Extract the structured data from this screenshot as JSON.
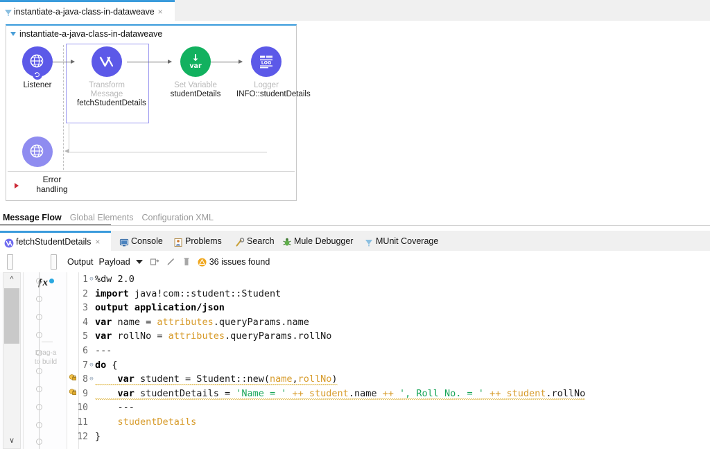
{
  "top_tab": {
    "title": "instantiate-a-java-class-in-dataweave",
    "close": "×",
    "icon": "munit-coverage-icon"
  },
  "flow": {
    "name": "instantiate-a-java-class-in-dataweave",
    "nodes": [
      {
        "id": "listener",
        "type": "Listener",
        "label": "Listener",
        "config": "",
        "icon": "http-globe-icon",
        "color": "#5c59e8",
        "dimmed_label": false
      },
      {
        "id": "transform",
        "type": "Transform Message",
        "label": "Transform Message",
        "config": "fetchStudentDetails",
        "icon": "transform-chevron-icon",
        "color": "#5c59e8",
        "dimmed_label": true
      },
      {
        "id": "setvar",
        "type": "Set Variable",
        "label": "Set Variable",
        "config": "studentDetails",
        "icon": "var-arrow-icon",
        "color": "#12b15f",
        "dimmed_label": true
      },
      {
        "id": "logger",
        "type": "Logger",
        "label": "Logger",
        "config": "INFO::studentDetails",
        "icon": "log-icon",
        "color": "#5c59e8",
        "dimmed_label": true
      }
    ],
    "source_response_icon": "http-globe-icon",
    "error_handling": "Error\nhandling",
    "error_handling_line1": "Error",
    "error_handling_line2": "handling",
    "selected_node": "transform"
  },
  "message_flow_tabs": [
    {
      "label": "Message Flow",
      "active": true
    },
    {
      "label": "Global Elements",
      "active": false
    },
    {
      "label": "Configuration XML",
      "active": false
    }
  ],
  "view_tabs": [
    {
      "label": "fetchStudentDetails",
      "icon": "dataweave-icon",
      "active": true,
      "closable": true
    },
    {
      "label": "Console",
      "icon": "console-icon",
      "active": false,
      "closable": false
    },
    {
      "label": "Problems",
      "icon": "problems-icon",
      "active": false,
      "closable": false
    },
    {
      "label": "Search",
      "icon": "search-icon",
      "active": false,
      "closable": false
    },
    {
      "label": "Mule Debugger",
      "icon": "mule-debugger-icon",
      "active": false,
      "closable": false
    },
    {
      "label": "MUnit Coverage",
      "icon": "munit-coverage-icon",
      "active": false,
      "closable": false
    }
  ],
  "editor_toolbar": {
    "output_label": "Output",
    "payload_label": "Payload",
    "dropdown_icon": "chevron-down-icon",
    "preview_icon": "preview-icon",
    "edit_icon": "pencil-icon",
    "delete_icon": "trash-icon",
    "warning_icon": "warning-triangle-icon",
    "issues_text": "36 issues found"
  },
  "left_panel": {
    "scroll_up_icon": "chevron-up-icon",
    "scroll_down_icon": "chevron-down-icon",
    "fx_label": "ƒx",
    "drag_hint_line1": "Drag-a",
    "drag_hint_line2": "to build"
  },
  "code": {
    "language": "dataweave",
    "lines": [
      {
        "num": 1,
        "fold": true,
        "warn": false,
        "tokens": [
          {
            "t": "%dw",
            "c": "plain"
          },
          {
            "t": " 2.0",
            "c": "plain"
          }
        ]
      },
      {
        "num": 2,
        "fold": false,
        "warn": false,
        "tokens": [
          {
            "t": "import",
            "c": "kw"
          },
          {
            "t": " java!com::student::Student",
            "c": "plain"
          }
        ]
      },
      {
        "num": 3,
        "fold": false,
        "warn": false,
        "tokens": [
          {
            "t": "output application/json",
            "c": "kw"
          }
        ]
      },
      {
        "num": 4,
        "fold": false,
        "warn": false,
        "tokens": [
          {
            "t": "var",
            "c": "kw"
          },
          {
            "t": " name = ",
            "c": "plain"
          },
          {
            "t": "attributes",
            "c": "ident"
          },
          {
            "t": ".queryParams.name",
            "c": "plain"
          }
        ]
      },
      {
        "num": 5,
        "fold": false,
        "warn": false,
        "tokens": [
          {
            "t": "var",
            "c": "kw"
          },
          {
            "t": " rollNo = ",
            "c": "plain"
          },
          {
            "t": "attributes",
            "c": "ident"
          },
          {
            "t": ".queryParams.rollNo",
            "c": "plain"
          }
        ]
      },
      {
        "num": 6,
        "fold": false,
        "warn": false,
        "tokens": [
          {
            "t": "---",
            "c": "plain"
          }
        ]
      },
      {
        "num": 7,
        "fold": true,
        "warn": false,
        "tokens": [
          {
            "t": "do",
            "c": "kw"
          },
          {
            "t": " {",
            "c": "plain"
          }
        ]
      },
      {
        "num": 8,
        "fold": true,
        "warn": true,
        "tokens": [
          {
            "t": "    ",
            "c": "plain"
          },
          {
            "t": "var",
            "c": "kw"
          },
          {
            "t": " student = Student::new(",
            "c": "plain"
          },
          {
            "t": "name",
            "c": "ident"
          },
          {
            "t": ",",
            "c": "plain"
          },
          {
            "t": "rollNo",
            "c": "ident"
          },
          {
            "t": ")",
            "c": "plain"
          }
        ]
      },
      {
        "num": 9,
        "fold": false,
        "warn": true,
        "tokens": [
          {
            "t": "    ",
            "c": "plain"
          },
          {
            "t": "var",
            "c": "kw"
          },
          {
            "t": " studentDetails = ",
            "c": "plain"
          },
          {
            "t": "'Name = '",
            "c": "str"
          },
          {
            "t": " ",
            "c": "plain"
          },
          {
            "t": "++",
            "c": "ident"
          },
          {
            "t": " student",
            "c": "ident"
          },
          {
            "t": ".name ",
            "c": "plain"
          },
          {
            "t": "++",
            "c": "ident"
          },
          {
            "t": " ",
            "c": "plain"
          },
          {
            "t": "', Roll No. = '",
            "c": "str"
          },
          {
            "t": " ",
            "c": "plain"
          },
          {
            "t": "++",
            "c": "ident"
          },
          {
            "t": " student",
            "c": "ident"
          },
          {
            "t": ".rollNo",
            "c": "plain"
          }
        ]
      },
      {
        "num": 10,
        "fold": false,
        "warn": false,
        "tokens": [
          {
            "t": "    ---",
            "c": "plain"
          }
        ]
      },
      {
        "num": 11,
        "fold": false,
        "warn": false,
        "tokens": [
          {
            "t": "    studentDetails",
            "c": "ident"
          }
        ]
      },
      {
        "num": 12,
        "fold": false,
        "warn": false,
        "tokens": [
          {
            "t": "}",
            "c": "plain"
          }
        ]
      }
    ]
  },
  "colors": {
    "accent_blue": "#3a9bdc",
    "node_indigo": "#5c59e8",
    "node_green": "#12b15f",
    "selection_border": "#9a97f0",
    "warning_amber": "#f0a71e",
    "string_green": "#18a558",
    "identifier_amber": "#d79b2a"
  }
}
